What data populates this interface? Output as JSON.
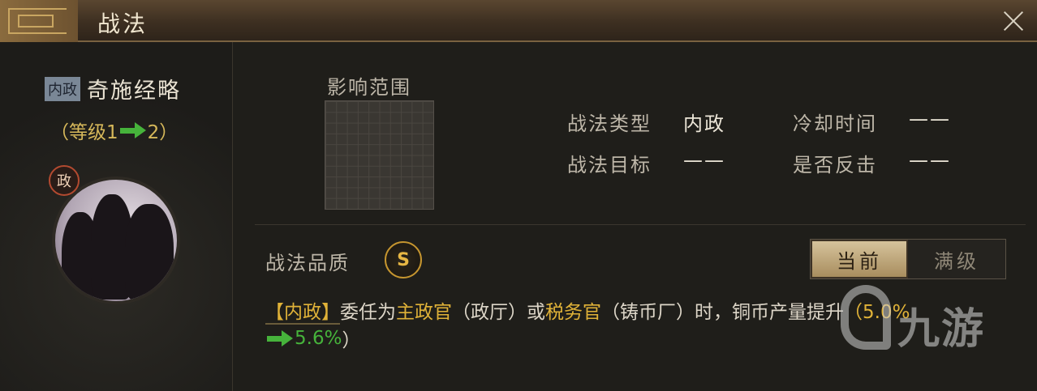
{
  "header": {
    "title": "战法"
  },
  "skill": {
    "type_tag": "内政",
    "name": "奇施经略",
    "level_open": "（等级1",
    "level_close": "2）",
    "portrait_badge": "政"
  },
  "range": {
    "label": "影响范围"
  },
  "info": {
    "type_label": "战法类型",
    "type_value": "内政",
    "target_label": "战法目标",
    "target_value": "——",
    "cooldown_label": "冷却时间",
    "cooldown_value": "——",
    "counter_label": "是否反击",
    "counter_value": "——"
  },
  "quality": {
    "label": "战法品质",
    "grade": "S"
  },
  "toggle": {
    "current": "当前",
    "max": "满级"
  },
  "description": {
    "tag": "【内政】",
    "part1": "委任为",
    "role1": "主政官",
    "part2": "（政厅）或",
    "role2": "税务官",
    "part3": "（铸币厂）时，铜币产量提升",
    "from_value": "（5.0%",
    "to_value": "5.6%",
    "close": "）"
  },
  "watermark": {
    "text": "九游"
  },
  "colors": {
    "gold": "#e0b238",
    "green": "#46b33b",
    "tab_active": "#d6c39c"
  }
}
